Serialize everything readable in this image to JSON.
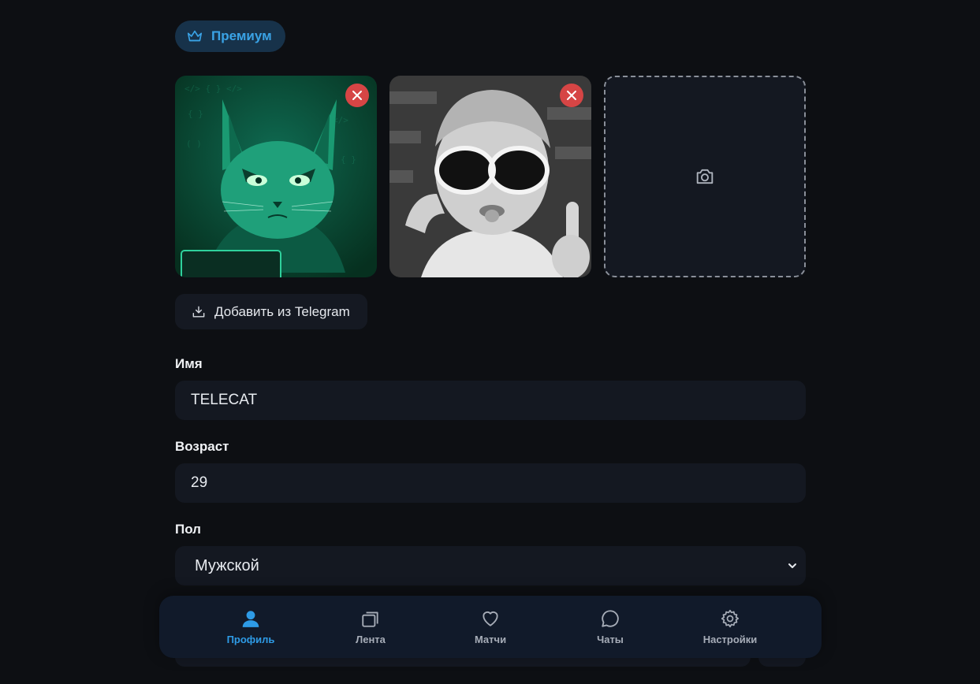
{
  "premium": {
    "label": "Премиум",
    "icon": "crown-icon",
    "color": "#3aa3e6"
  },
  "photos": {
    "items": [
      {
        "alt": "cat-hacker-avatar",
        "remove_icon": "close-icon"
      },
      {
        "alt": "kid-with-sunglasses",
        "remove_icon": "close-icon"
      }
    ],
    "add_icon": "camera-icon"
  },
  "telegram_import": {
    "label": "Добавить из Telegram",
    "icon": "download-tray-icon"
  },
  "form": {
    "name": {
      "label": "Имя",
      "value": "TELECAT"
    },
    "age": {
      "label": "Возраст",
      "value": "29"
    },
    "gender": {
      "label": "Пол",
      "value": "Мужской",
      "icon": "chevron-down-icon"
    }
  },
  "nav": {
    "active_color": "#2e9be6",
    "items": [
      {
        "label": "Профиль",
        "icon": "user-icon",
        "active": true
      },
      {
        "label": "Лента",
        "icon": "cards-icon",
        "active": false
      },
      {
        "label": "Матчи",
        "icon": "heart-icon",
        "active": false
      },
      {
        "label": "Чаты",
        "icon": "chat-bubble-icon",
        "active": false
      },
      {
        "label": "Настройки",
        "icon": "gear-icon",
        "active": false
      }
    ]
  }
}
